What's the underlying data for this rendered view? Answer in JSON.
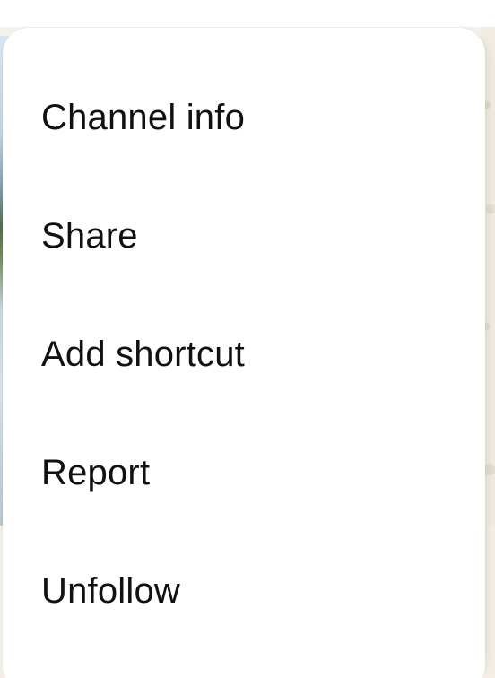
{
  "menu": {
    "items": [
      {
        "label": "Channel info"
      },
      {
        "label": "Share"
      },
      {
        "label": "Add shortcut"
      },
      {
        "label": "Report"
      },
      {
        "label": "Unfollow"
      }
    ]
  }
}
